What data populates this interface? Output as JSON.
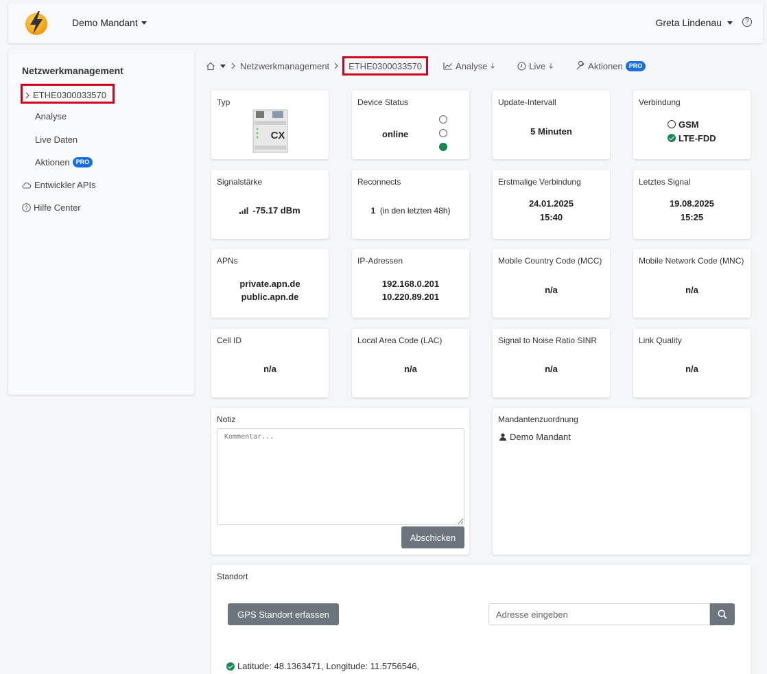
{
  "topbar": {
    "tenant_label": "Demo Mandant",
    "user_label": "Greta Lindenau",
    "help_glyph": "?"
  },
  "sidebar": {
    "title": "Netzwerkmanagement",
    "device_id": "ETHE0300033570",
    "items": [
      {
        "label": "Analyse"
      },
      {
        "label": "Live Daten"
      },
      {
        "label": "Aktionen",
        "badge": "PRO"
      }
    ],
    "root_items": [
      {
        "label": "Entwickler APIs",
        "icon": "cloud-icon"
      },
      {
        "label": "Hilfe Center",
        "icon": "help-circle-icon"
      }
    ]
  },
  "breadcrumb": {
    "section": "Netzwerkmanagement",
    "current": "ETHE0300033570",
    "analyse_label": "Analyse",
    "live_label": "Live",
    "aktionen_label": "Aktionen",
    "pro_badge": "PRO"
  },
  "cards": {
    "typ": {
      "label": "Typ",
      "device_mark": "CX"
    },
    "device_status": {
      "label": "Device Status",
      "value": "online",
      "indicator": [
        "off",
        "off",
        "on"
      ]
    },
    "update_interval": {
      "label": "Update-Intervall",
      "value": "5 Minuten"
    },
    "verbindung": {
      "label": "Verbindung",
      "options": [
        "GSM",
        "LTE-FDD"
      ],
      "selected": "LTE-FDD"
    },
    "signal": {
      "label": "Signalstärke",
      "value": "-75.17 dBm"
    },
    "reconnects": {
      "label": "Reconnects",
      "count": "1",
      "note": "(in den letzten 48h)"
    },
    "first_connection": {
      "label": "Erstmalige Verbindung",
      "date": "24.01.2025",
      "time": "15:40"
    },
    "last_signal": {
      "label": "Letztes Signal",
      "date": "19.08.2025",
      "time": "15:25"
    },
    "apns": {
      "label": "APNs",
      "values": [
        "private.apn.de",
        "public.apn.de"
      ]
    },
    "ip": {
      "label": "IP-Adressen",
      "values": [
        "192.168.0.201",
        "10.220.89.201"
      ]
    },
    "mcc": {
      "label": "Mobile Country Code (MCC)",
      "value": "n/a"
    },
    "mnc": {
      "label": "Mobile Network Code (MNC)",
      "value": "n/a"
    },
    "cell_id": {
      "label": "Cell ID",
      "value": "n/a"
    },
    "lac": {
      "label": "Local Area Code (LAC)",
      "value": "n/a"
    },
    "sinr": {
      "label": "Signal to Noise Ratio SINR",
      "value": "n/a"
    },
    "link_quality": {
      "label": "Link Quality",
      "value": "n/a"
    }
  },
  "notiz": {
    "label": "Notiz",
    "placeholder": "Kommentar...",
    "submit_label": "Abschicken"
  },
  "mandant": {
    "label": "Mandantenzuordnung",
    "value": "Demo Mandant"
  },
  "standort": {
    "label": "Standort",
    "gps_button": "GPS Standort erfassen",
    "address_placeholder": "Adresse eingeben",
    "coordinates": "Latitude: 48.1363471, Longitude: 11.5756546,"
  },
  "colors": {
    "accent_blue": "#1a6fe0",
    "success_green": "#198754",
    "highlight_red": "#d0021b",
    "button_gray": "#6c757d"
  }
}
